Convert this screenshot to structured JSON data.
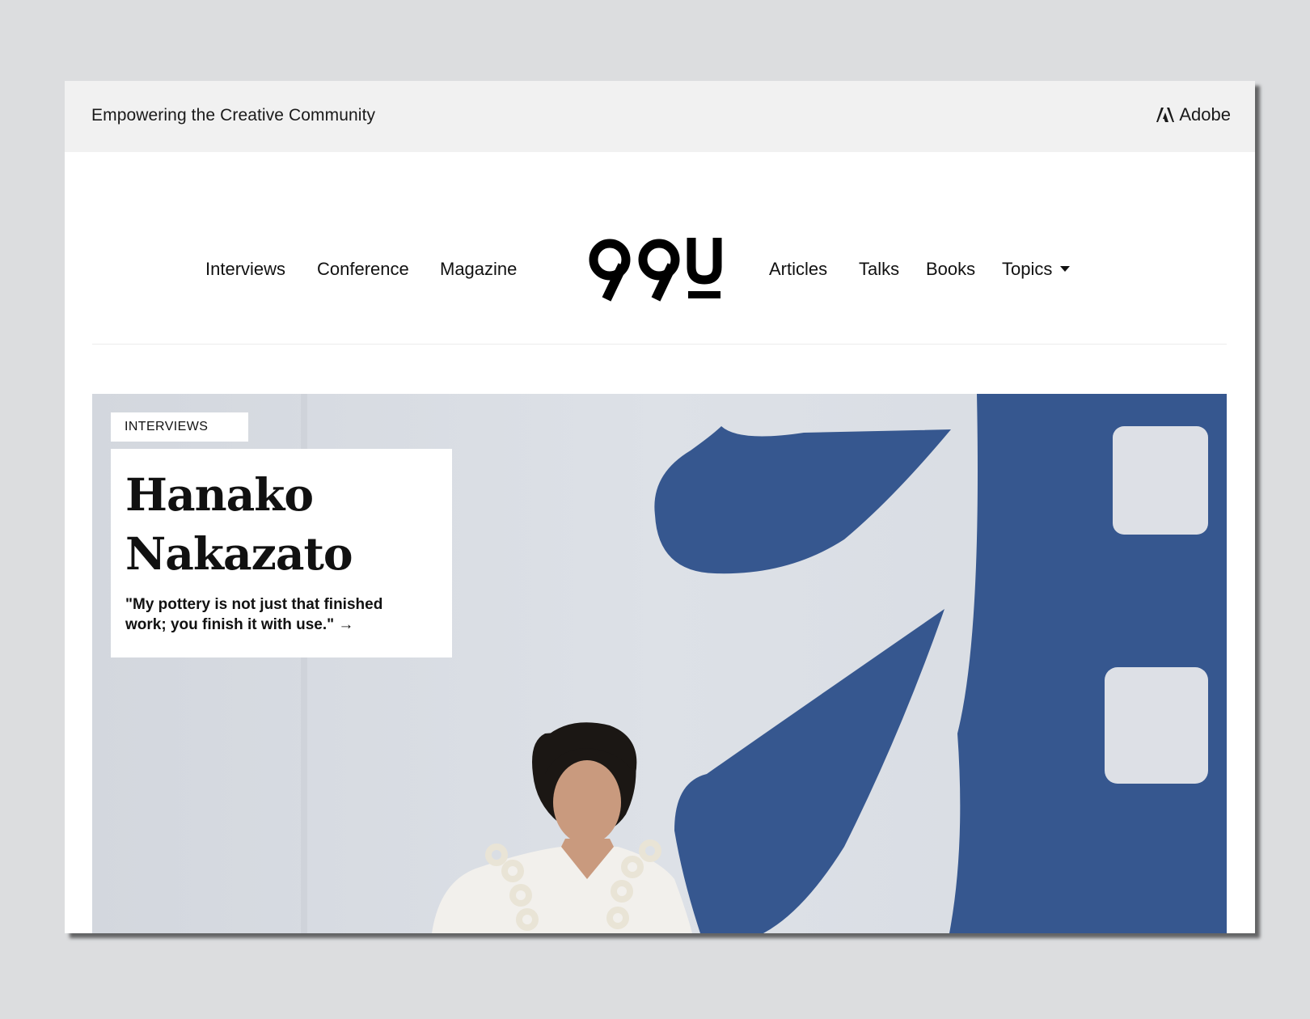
{
  "topbar": {
    "tagline": "Empowering the Creative Community",
    "adobe_label": "Adobe"
  },
  "nav": {
    "left": [
      "Interviews",
      "Conference",
      "Magazine"
    ],
    "logo": "99U",
    "right": [
      "Articles",
      "Talks",
      "Books",
      "Topics"
    ]
  },
  "hero": {
    "category": "INTERVIEWS",
    "title_line1": "Hanako",
    "title_line2": "Nakazato",
    "quote": "\"My pottery is not just that finished work; you finish it with use.\" →"
  },
  "colors": {
    "background": "#dcdddf",
    "topbar": "#f1f1f1",
    "mural_blue": "#36578f",
    "wall": "#d9dde3"
  }
}
